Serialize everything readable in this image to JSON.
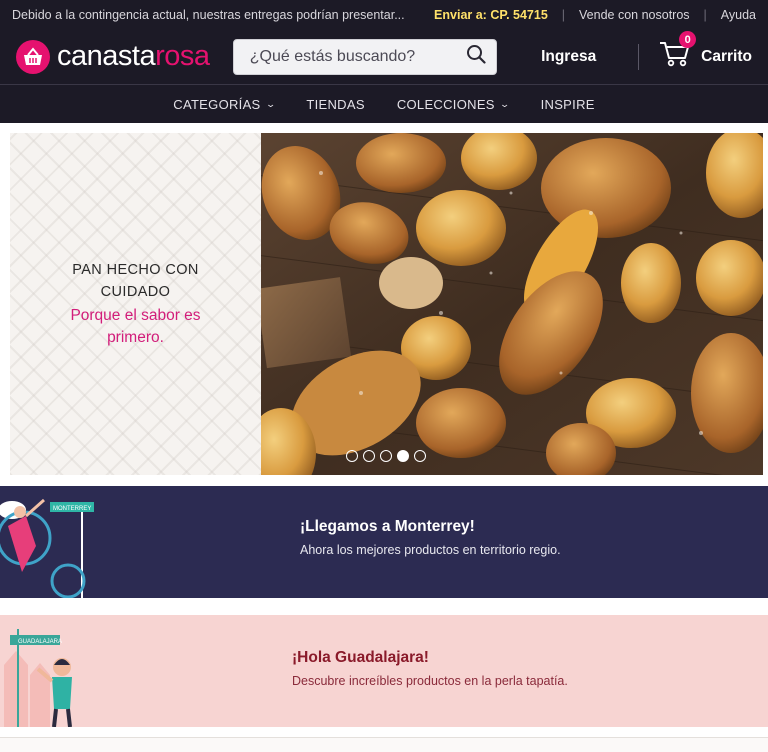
{
  "topbar": {
    "notice": "Debido a la contingencia actual, nuestras entregas podrían presentar...",
    "shipping": "Enviar a: CP. 54715",
    "sell_link": "Vende con nosotros",
    "help_link": "Ayuda"
  },
  "header": {
    "logo_part1": "canasta",
    "logo_part2": "rosa",
    "search_placeholder": "¿Qué estás buscando?",
    "login_label": "Ingresa",
    "cart_label": "Carrito",
    "cart_count": "0"
  },
  "nav": {
    "items": [
      "CATEGORÍAS",
      "TIENDAS",
      "COLECCIONES",
      "INSPIRE"
    ]
  },
  "hero": {
    "title": "PAN HECHO CON CUIDADO",
    "subtitle": "Porque el sabor es primero.",
    "active_slide": 4,
    "slide_count": 5
  },
  "banners": {
    "monterrey": {
      "title": "¡Llegamos a Monterrey!",
      "subtitle": "Ahora los mejores productos en territorio regio.",
      "sign": "MONTERREY"
    },
    "guadalajara": {
      "title": "¡Hola Guadalajara!",
      "subtitle": "Descubre increíbles productos en la perla tapatía.",
      "sign": "GUADALAJARA"
    }
  },
  "colors": {
    "brand": "#e5126f",
    "header_bg": "#1c1a26",
    "mty_bg": "#2c2b52",
    "gdl_bg": "#f7d4d2",
    "accent_yellow": "#ffe16a"
  }
}
